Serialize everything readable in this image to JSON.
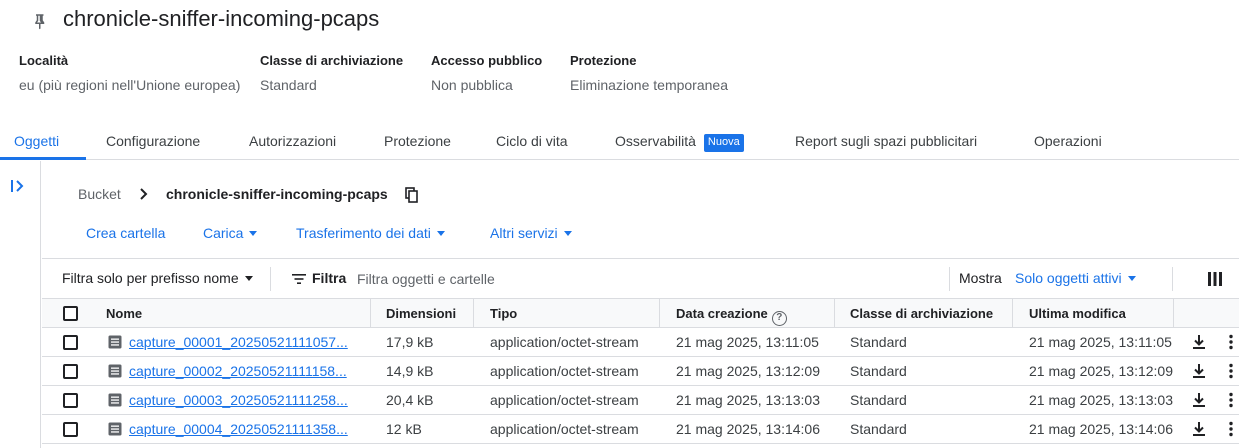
{
  "bucket": {
    "name": "chronicle-sniffer-incoming-pcaps"
  },
  "properties": [
    {
      "label": "Località",
      "value": "eu (più regioni nell'Unione europea)"
    },
    {
      "label": "Classe di archiviazione",
      "value": "Standard"
    },
    {
      "label": "Accesso pubblico",
      "value": "Non pubblica"
    },
    {
      "label": "Protezione",
      "value": "Eliminazione temporanea"
    }
  ],
  "tabs": [
    {
      "label": "Oggetti",
      "active": true
    },
    {
      "label": "Configurazione"
    },
    {
      "label": "Autorizzazioni"
    },
    {
      "label": "Protezione"
    },
    {
      "label": "Ciclo di vita"
    },
    {
      "label": "Osservabilità",
      "badge": "Nuova"
    },
    {
      "label": "Report sugli spazi pubblicitari"
    },
    {
      "label": "Operazioni"
    }
  ],
  "breadcrumb": {
    "root": "Bucket",
    "current": "chronicle-sniffer-incoming-pcaps"
  },
  "actions": {
    "create_folder": "Crea cartella",
    "upload": "Carica",
    "transfer": "Trasferimento dei dati",
    "other": "Altri servizi"
  },
  "filterbar": {
    "prefix_label": "Filtra solo per prefisso nome",
    "filter_label": "Filtra",
    "placeholder": "Filtra oggetti e cartelle",
    "show_label": "Mostra",
    "show_value": "Solo oggetti attivi"
  },
  "table": {
    "headers": {
      "name": "Nome",
      "size": "Dimensioni",
      "type": "Tipo",
      "created": "Data creazione",
      "storage_class": "Classe di archiviazione",
      "modified": "Ultima modifica"
    },
    "rows": [
      {
        "name": "capture_00001_20250521111057...",
        "size": "17,9 kB",
        "type": "application/octet-stream",
        "created": "21 mag 2025, 13:11:05",
        "storage_class": "Standard",
        "modified": "21 mag 2025, 13:11:05"
      },
      {
        "name": "capture_00002_20250521111158...",
        "size": "14,9 kB",
        "type": "application/octet-stream",
        "created": "21 mag 2025, 13:12:09",
        "storage_class": "Standard",
        "modified": "21 mag 2025, 13:12:09"
      },
      {
        "name": "capture_00003_20250521111258...",
        "size": "20,4 kB",
        "type": "application/octet-stream",
        "created": "21 mag 2025, 13:13:03",
        "storage_class": "Standard",
        "modified": "21 mag 2025, 13:13:03"
      },
      {
        "name": "capture_00004_20250521111358...",
        "size": "12 kB",
        "type": "application/octet-stream",
        "created": "21 mag 2025, 13:14:06",
        "storage_class": "Standard",
        "modified": "21 mag 2025, 13:14:06"
      }
    ]
  },
  "colors": {
    "accent": "#1a73e8",
    "text": "#202124",
    "muted": "#5f6368",
    "border": "#dadce0"
  }
}
